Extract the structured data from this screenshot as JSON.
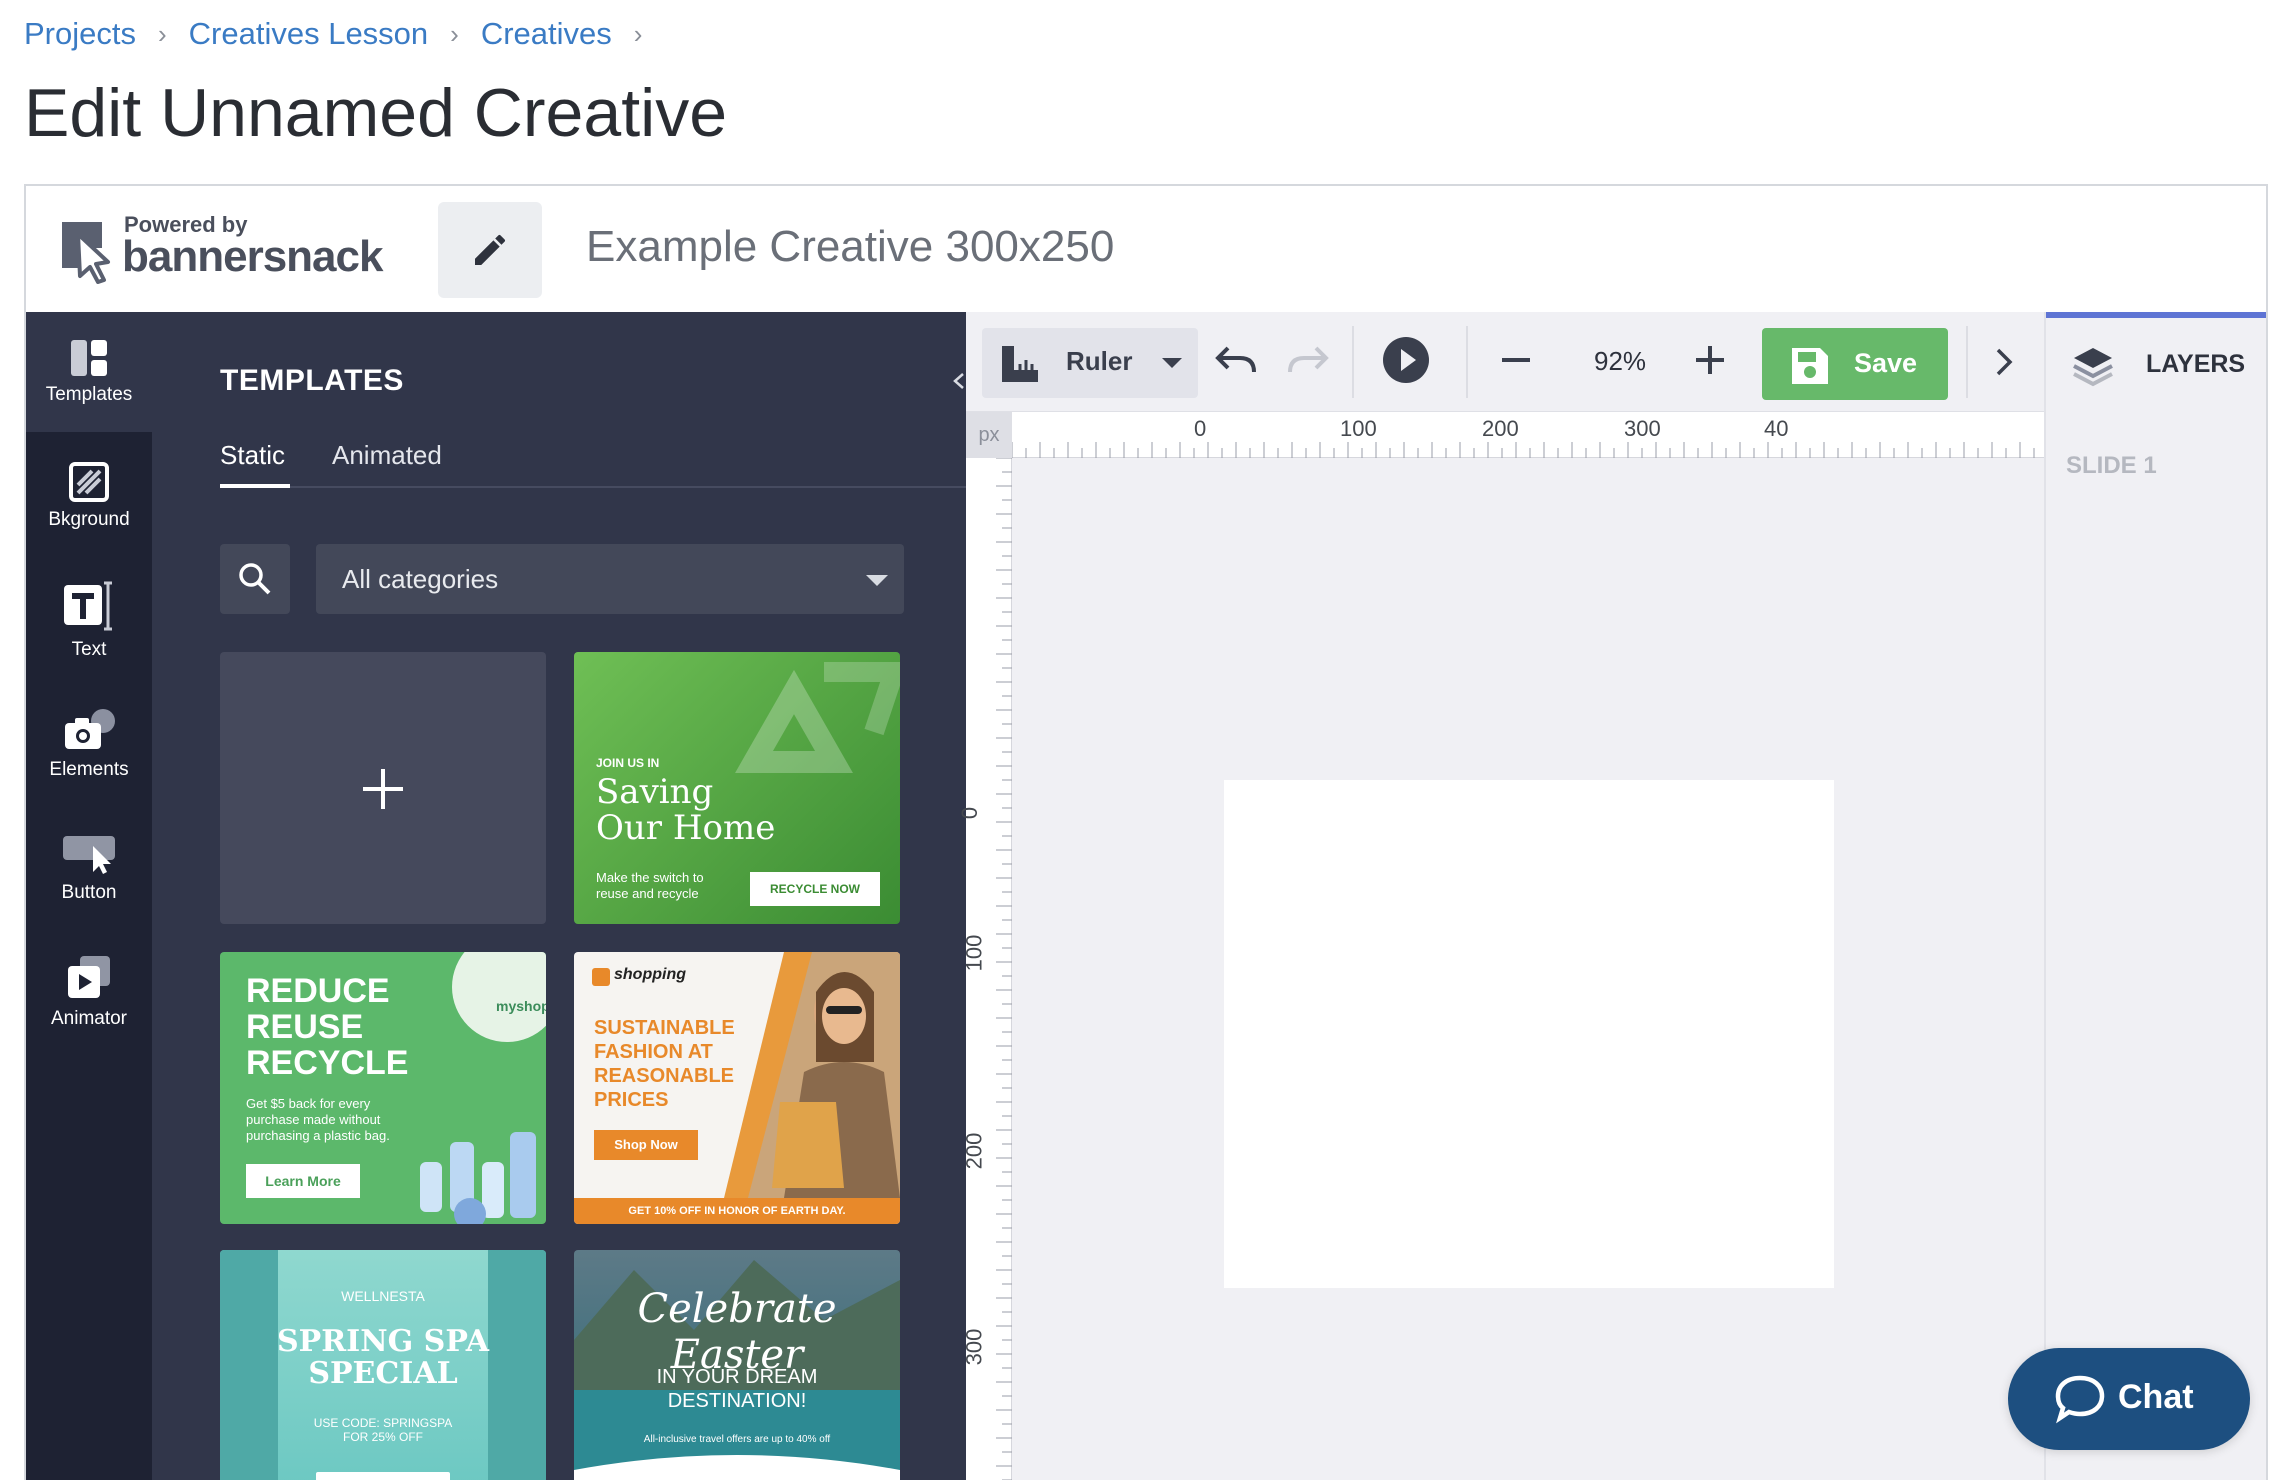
{
  "breadcrumb": [
    "Projects",
    "Creatives Lesson",
    "Creatives"
  ],
  "breadcrumb_separator": "›",
  "page_title": "Edit Unnamed Creative",
  "editor": {
    "logo": {
      "line1": "Powered by",
      "line2": "bannersnack"
    },
    "creative_name": "Example Creative 300x250"
  },
  "rail": [
    {
      "label": "Templates",
      "icon": "templates-icon"
    },
    {
      "label": "Bkground",
      "icon": "background-icon"
    },
    {
      "label": "Text",
      "icon": "text-icon"
    },
    {
      "label": "Elements",
      "icon": "camera-icon"
    },
    {
      "label": "Button",
      "icon": "button-icon"
    },
    {
      "label": "Animator",
      "icon": "animator-icon"
    }
  ],
  "templates_panel": {
    "title": "TEMPLATES",
    "tabs": [
      "Static",
      "Animated"
    ],
    "active_tab": "Static",
    "category_select": "All categories"
  },
  "template_tiles": {
    "t1": {
      "kicker": "JOIN US IN",
      "title_l1": "Saving",
      "title_l2": "Our Home",
      "sub_l1": "Make the switch to",
      "sub_l2": "reuse and recycle",
      "cta": "RECYCLE NOW"
    },
    "t2": {
      "l1": "REDUCE",
      "l2": "REUSE",
      "l3": "RECYCLE",
      "body_l1": "Get $5 back for every",
      "body_l2": "purchase made without",
      "body_l3": "purchasing a plastic bag.",
      "cta": "Learn More",
      "brand": "myshop"
    },
    "t3": {
      "brand": "shopping",
      "l1": "SUSTAINABLE",
      "l2": "FASHION AT",
      "l3": "REASONABLE",
      "l4": "PRICES",
      "cta": "Shop Now",
      "footer": "GET 10% OFF IN HONOR OF EARTH DAY."
    },
    "t4": {
      "brand": "WELLNESTA",
      "l1": "SPRING SPA",
      "l2": "SPECIAL",
      "code_l1": "USE CODE: SPRINGSPA",
      "code_l2": "FOR 25% OFF"
    },
    "t5": {
      "script": "Celebrate Easter",
      "l1": "IN YOUR DREAM",
      "l2": "DESTINATION!",
      "small": "All-inclusive travel offers are up to 40% off"
    }
  },
  "toolbar": {
    "ruler_label": "Ruler",
    "zoom": "92%",
    "save_label": "Save"
  },
  "ruler": {
    "unit": "px",
    "h_ticks": [
      "0",
      "100",
      "200",
      "300",
      "40"
    ],
    "v_ticks": [
      "0",
      "100",
      "200",
      "300"
    ]
  },
  "layers": {
    "title": "LAYERS",
    "slide": "SLIDE 1"
  },
  "chat": {
    "label": "Chat"
  },
  "colors": {
    "accent": "#3a7bc4",
    "rail": "#1e2233",
    "panel": "#31364a",
    "save": "#67b96a",
    "chat": "#1d4f80",
    "layers_accent": "#5e74d4"
  }
}
